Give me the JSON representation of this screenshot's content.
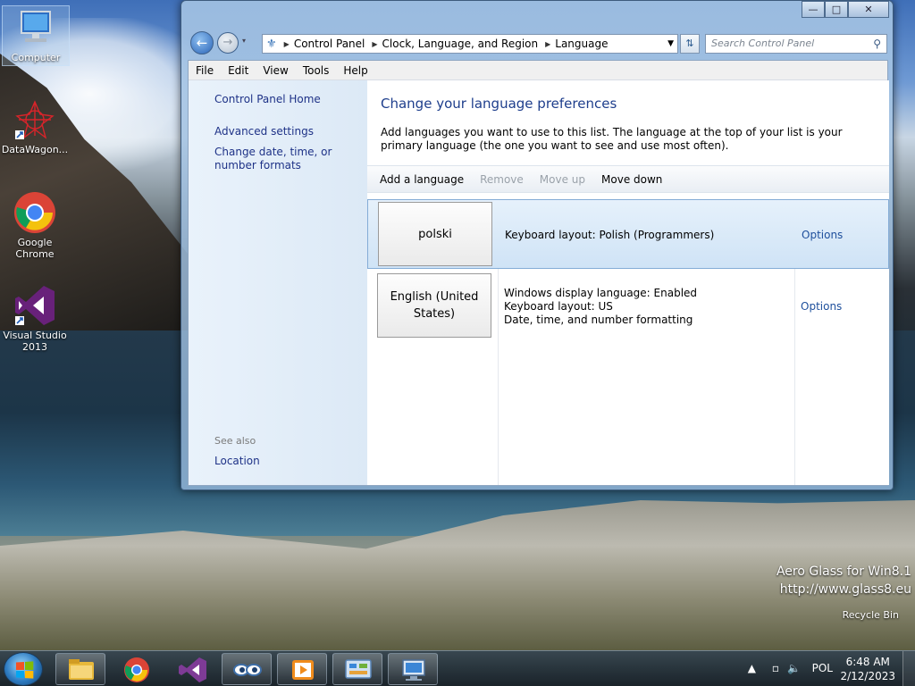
{
  "desktop": {
    "icons": [
      {
        "label": "Computer"
      },
      {
        "label": "DataWagon..."
      },
      {
        "label": "Google Chrome"
      },
      {
        "label": "Visual Studio 2013"
      }
    ],
    "watermark_line1": "Aero Glass for Win8.1",
    "watermark_line2": "http://www.glass8.eu",
    "recycle_bin": "Recycle Bin"
  },
  "window": {
    "caption_buttons": {
      "minimize": "—",
      "maximize": "□",
      "close": "✕"
    },
    "address": {
      "crumbs": [
        "Control Panel",
        "Clock, Language, and Region",
        "Language"
      ]
    },
    "search_placeholder": "Search Control Panel",
    "menu": [
      "File",
      "Edit",
      "View",
      "Tools",
      "Help"
    ],
    "left_pane": {
      "home": "Control Panel Home",
      "advanced": "Advanced settings",
      "change_date": "Change date, time, or number formats",
      "see_also": "See also",
      "location": "Location"
    },
    "main": {
      "title": "Change your language preferences",
      "description": "Add languages you want to use to this list. The language at the top of your list is your primary language (the one you want to see and use most often).",
      "toolbar": {
        "add": "Add a language",
        "remove": "Remove",
        "move_up": "Move up",
        "move_down": "Move down"
      },
      "languages": [
        {
          "name": "polski",
          "info": [
            "Keyboard layout: Polish (Programmers)"
          ],
          "options": "Options"
        },
        {
          "name": "English (United States)",
          "info": [
            "Windows display language: Enabled",
            "Keyboard layout: US",
            "Date, time, and number formatting"
          ],
          "options": "Options"
        }
      ]
    }
  },
  "taskbar": {
    "lang": "POL",
    "time": "6:48 AM",
    "date": "2/12/2023",
    "colors": {
      "accent": "#1e4f9c",
      "link": "#1e3287",
      "title": "#1e3e8c"
    }
  }
}
